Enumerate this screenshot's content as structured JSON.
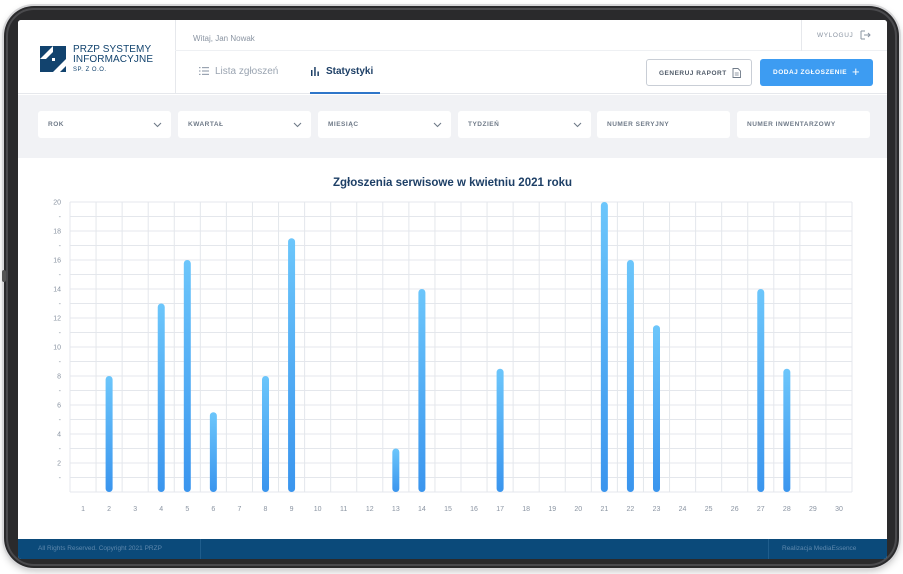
{
  "brand": {
    "line1": "PRZP SYSTEMY",
    "line2": "INFORMACYJNE",
    "line3": "SP. Z O.O."
  },
  "header": {
    "greeting": "Witaj, Jan Nowak",
    "logout_label": "WYLOGUJ",
    "tabs": [
      {
        "label": "Lista zgłoszeń",
        "icon": "list-icon",
        "active": false
      },
      {
        "label": "Statystyki",
        "icon": "bar-chart-icon",
        "active": true
      }
    ],
    "report_button": "GENERUJ RAPORT",
    "add_button": "DODAJ ZGŁOSZENIE"
  },
  "filters": [
    {
      "label": "ROK",
      "type": "select"
    },
    {
      "label": "KWARTAŁ",
      "type": "select"
    },
    {
      "label": "MIESIĄC",
      "type": "select"
    },
    {
      "label": "TYDZIEŃ",
      "type": "select"
    },
    {
      "label": "NUMER SERYJNY",
      "type": "text"
    },
    {
      "label": "NUMER INWENTARZOWY",
      "type": "text"
    }
  ],
  "chart_data": {
    "type": "bar",
    "title": "Zgłoszenia serwisowe w kwietniu 2021 roku",
    "xlabel": "",
    "ylabel": "",
    "x": [
      1,
      2,
      3,
      4,
      5,
      6,
      7,
      8,
      9,
      10,
      11,
      12,
      13,
      14,
      15,
      16,
      17,
      18,
      19,
      20,
      21,
      22,
      23,
      24,
      25,
      26,
      27,
      28,
      29,
      30
    ],
    "values": [
      0,
      8,
      0,
      13,
      16,
      5.5,
      0,
      8,
      17.5,
      0,
      0,
      0,
      3,
      14,
      0,
      0,
      8.5,
      0,
      0,
      0,
      20,
      16,
      11.5,
      0,
      0,
      0,
      14,
      8.5,
      0,
      0
    ],
    "ylim": [
      0,
      20
    ],
    "y_ticks": [
      "20",
      "-",
      "18",
      "-",
      "16",
      "-",
      "14",
      "-",
      "12",
      "-",
      "10",
      "-",
      "8",
      "-",
      "6",
      "-",
      "4",
      "-",
      "2",
      "-"
    ],
    "grid": true,
    "colors": {
      "bar_top": "#6cc6fb",
      "bar_bottom": "#3a95ee",
      "grid": "#e4e7ec",
      "tick": "#8a94a2"
    }
  },
  "footer": {
    "copyright": "All Rights Reserved. Copyright 2021 PRZP",
    "credit": "Realizacja MediaEssence"
  }
}
